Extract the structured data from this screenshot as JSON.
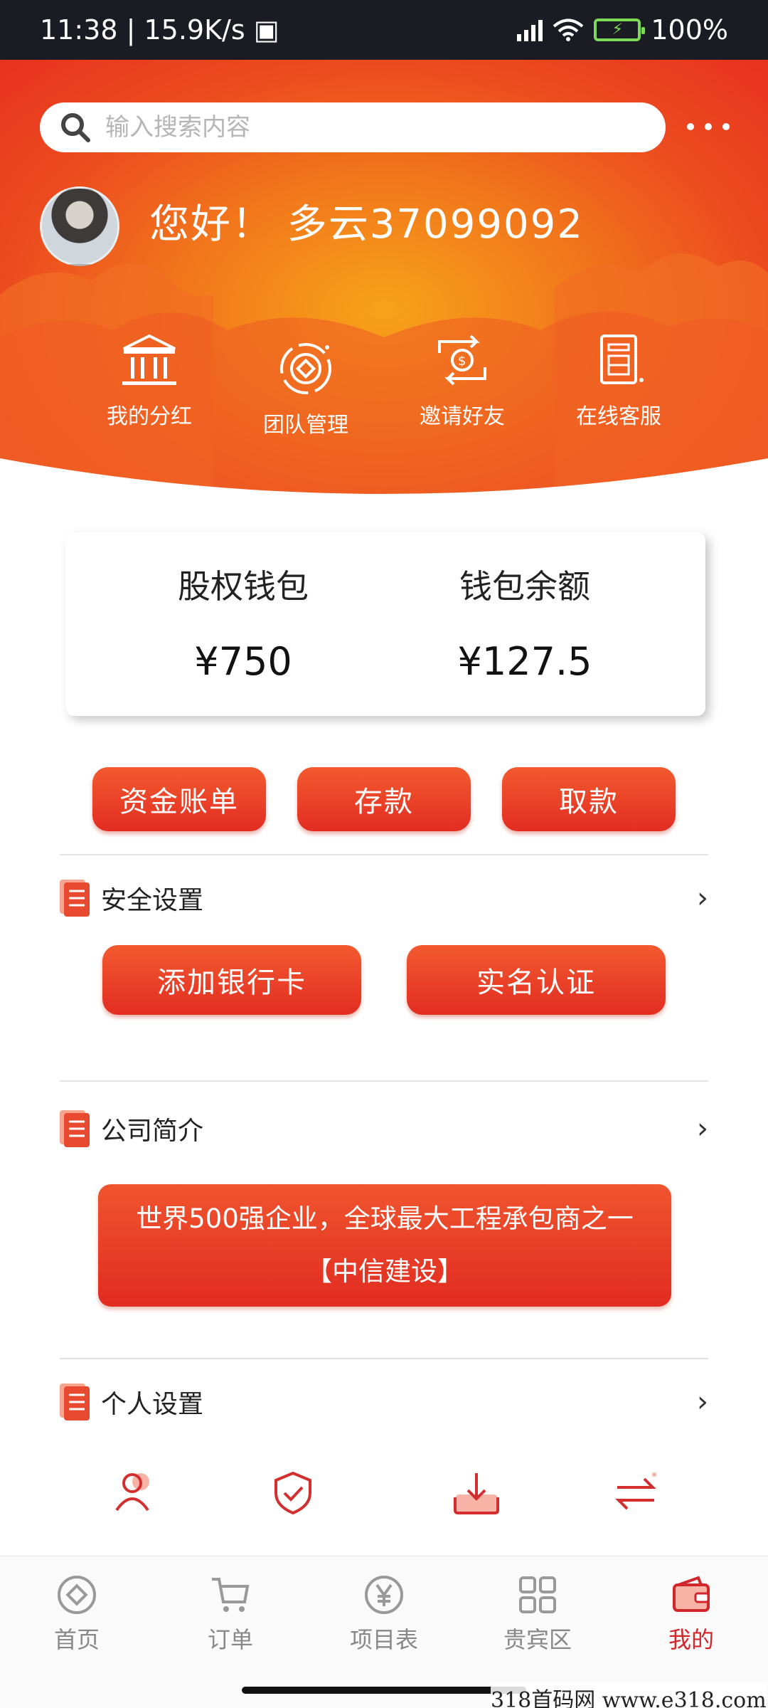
{
  "status_bar": {
    "time": "11:38",
    "speed": "15.9K/s",
    "battery": "100%"
  },
  "search": {
    "placeholder": "输入搜索内容"
  },
  "user": {
    "greeting": "您好！ 多云37099092"
  },
  "quick_actions": [
    {
      "label": "我的分红",
      "icon": "bank-icon"
    },
    {
      "label": "团队管理",
      "icon": "team-target-icon"
    },
    {
      "label": "邀请好友",
      "icon": "invite-exchange-icon"
    },
    {
      "label": "在线客服",
      "icon": "service-receipt-icon"
    }
  ],
  "wallet": {
    "equity_label": "股权钱包",
    "equity_value": "¥750",
    "balance_label": "钱包余额",
    "balance_value": "¥127.5"
  },
  "actions": {
    "bill": "资金账单",
    "deposit": "存款",
    "withdraw": "取款"
  },
  "security": {
    "title": "安全设置",
    "add_card": "添加银行卡",
    "verify": "实名认证"
  },
  "company": {
    "title": "公司简介",
    "line1": "世界500强企业，全球最大工程承包商之一",
    "line2": "【中信建设】"
  },
  "personal": {
    "title": "个人设置"
  },
  "tabs": [
    {
      "label": "首页",
      "icon": "home-coin-icon"
    },
    {
      "label": "订单",
      "icon": "cart-icon"
    },
    {
      "label": "项目表",
      "icon": "yuan-coin-icon"
    },
    {
      "label": "贵宾区",
      "icon": "grid-icon"
    },
    {
      "label": "我的",
      "icon": "wallet-icon"
    }
  ],
  "colors": {
    "brand_red": "#e32d22",
    "header_orange": "#f27a1b",
    "active_tab": "#d2262a"
  },
  "watermark": "318首码网 www.e318.com"
}
